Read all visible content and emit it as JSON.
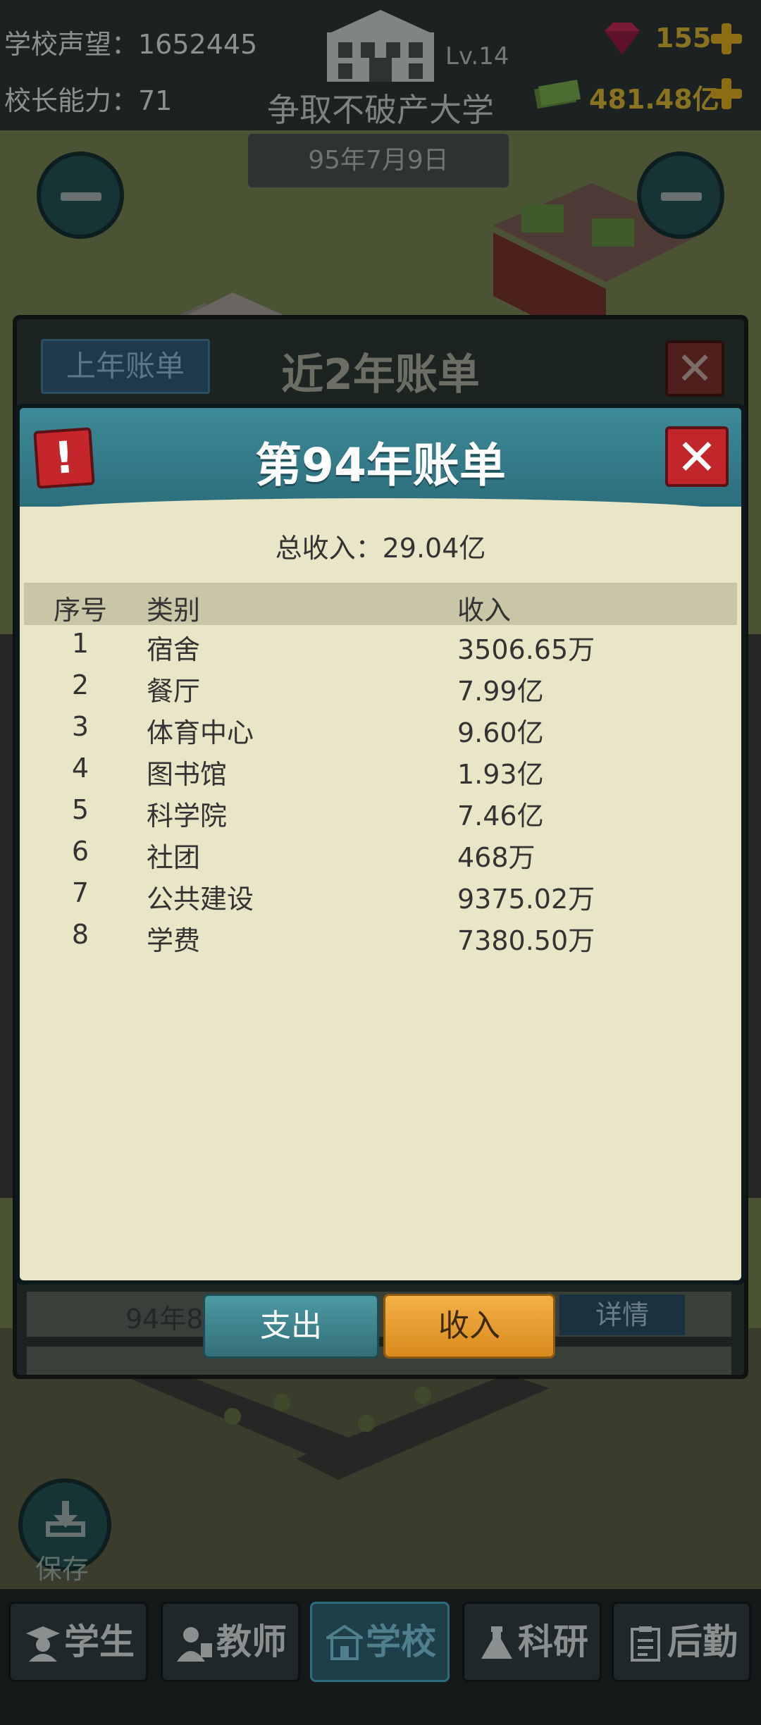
{
  "topbar": {
    "reputation_label": "学校声望：1652445",
    "ability_label": "校长能力：71",
    "level": "Lv.14",
    "school_name": "争取不破产大学",
    "date": "95年7月9日",
    "gems": "155",
    "money": "481.48亿"
  },
  "outer_dialog": {
    "tab_label": "上年账单",
    "title": "近2年账单",
    "close_label": "✕",
    "row_text": "94年8月",
    "detail_label": "详情"
  },
  "dialog": {
    "title": "第94年账单",
    "warning_glyph": "!",
    "close_label": "✕",
    "total_income": "总收入：29.04亿",
    "columns": [
      "序号",
      "类别",
      "收入"
    ],
    "rows": [
      {
        "no": "1",
        "category": "宿舍",
        "income": "3506.65万"
      },
      {
        "no": "2",
        "category": "餐厅",
        "income": "7.99亿"
      },
      {
        "no": "3",
        "category": "体育中心",
        "income": "9.60亿"
      },
      {
        "no": "4",
        "category": "图书馆",
        "income": "1.93亿"
      },
      {
        "no": "5",
        "category": "科学院",
        "income": "7.46亿"
      },
      {
        "no": "6",
        "category": "社团",
        "income": "468万"
      },
      {
        "no": "7",
        "category": "公共建设",
        "income": "9375.02万"
      },
      {
        "no": "8",
        "category": "学费",
        "income": "7380.50万"
      }
    ],
    "tab_expense": "支出",
    "tab_income": "收入"
  },
  "save": {
    "label": "保存"
  },
  "nav": {
    "items": [
      {
        "label": "学生",
        "icon": "student-icon"
      },
      {
        "label": "教师",
        "icon": "teacher-icon"
      },
      {
        "label": "学校",
        "icon": "school-icon"
      },
      {
        "label": "科研",
        "icon": "flask-icon"
      },
      {
        "label": "后勤",
        "icon": "clipboard-icon"
      }
    ],
    "active_index": 2
  },
  "colors": {
    "header_teal": "#3e8a98",
    "paper": "#e8e6c6",
    "close_red": "#c2262b",
    "income_orange": "#f3b047",
    "expense_teal": "#4b9aa3"
  }
}
